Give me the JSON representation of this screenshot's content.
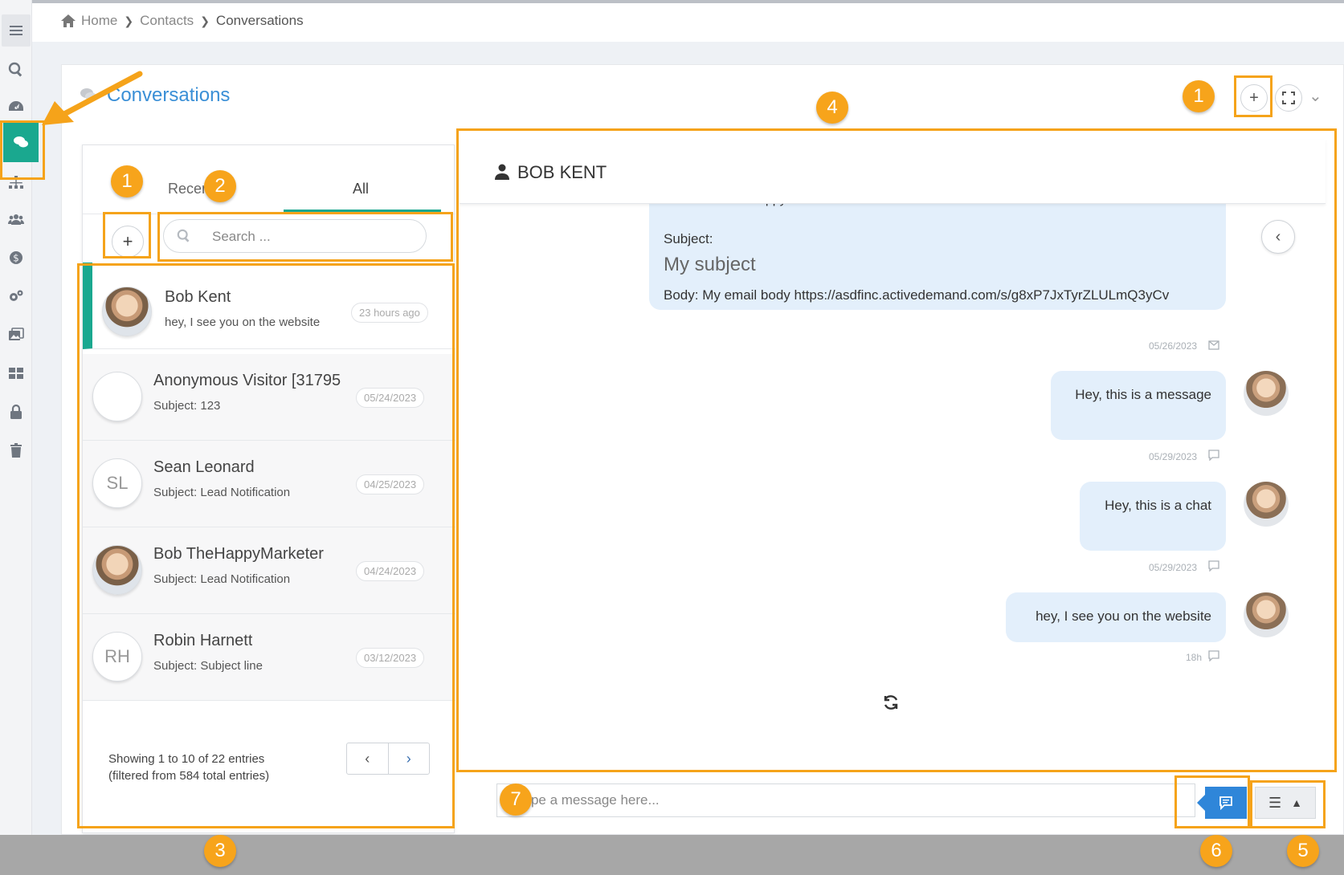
{
  "breadcrumb": {
    "home": "Home",
    "contacts": "Contacts",
    "current": "Conversations"
  },
  "panel": {
    "title": "Conversations"
  },
  "list": {
    "tabs": [
      {
        "label": "Recent"
      },
      {
        "label": "All"
      }
    ],
    "active_tab": "All",
    "search_placeholder": "Search ...",
    "conversations": [
      {
        "name": "Bob Kent",
        "subtitle": "hey, I see you on the website",
        "time": "23 hours ago",
        "avatar": "photo"
      },
      {
        "name": "Anonymous Visitor [31795",
        "subtitle": "Subject: 123",
        "time": "05/24/2023",
        "avatar": ""
      },
      {
        "name": "Sean Leonard",
        "subtitle": "Subject: Lead Notification",
        "time": "04/25/2023",
        "avatar": "SL"
      },
      {
        "name": "Bob TheHappyMarketer",
        "subtitle": "Subject: Lead Notification",
        "time": "04/24/2023",
        "avatar": "photo"
      },
      {
        "name": "Robin Harnett",
        "subtitle": "Subject: Subject line",
        "time": "03/12/2023",
        "avatar": "RH"
      }
    ],
    "showing_line1": "Showing 1 to 10 of 22 entries",
    "showing_line2": "(filtered from 584 total entries)"
  },
  "chat": {
    "contact_name": "BOB KENT",
    "email": {
      "from": "From:  Bob TheHappyMarketer",
      "subject_label": "Subject:",
      "subject": "My subject",
      "body": "Body: My email body https://asdfinc.activedemand.com/s/g8xP7JxTyrZLULmQ3yCv",
      "date": "05/26/2023"
    },
    "messages": [
      {
        "text": "Hey, this is a message",
        "date": "05/29/2023"
      },
      {
        "text": "Hey, this is a chat",
        "date": "05/29/2023"
      },
      {
        "text": "hey, I see you on the website",
        "date": "18h"
      }
    ],
    "composer_placeholder": "Type a message here..."
  },
  "annotations": {
    "badges": [
      "1",
      "1",
      "2",
      "3",
      "4",
      "5",
      "6",
      "7"
    ]
  },
  "colors": {
    "accent": "#1aa88f",
    "link": "#3a8fd6",
    "annotation": "#f5a31a",
    "send": "#2f86d9"
  }
}
